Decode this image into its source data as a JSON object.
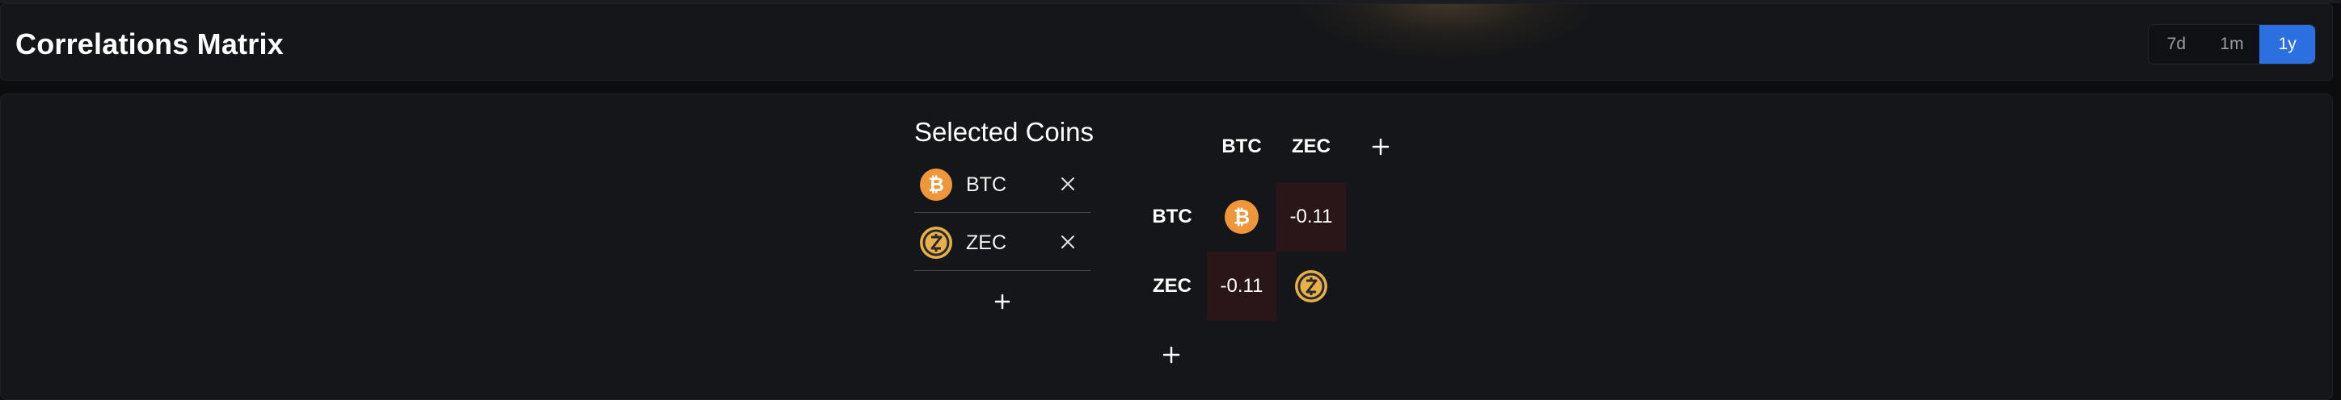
{
  "header": {
    "title": "Correlations Matrix",
    "ranges": [
      {
        "label": "7d",
        "active": false
      },
      {
        "label": "1m",
        "active": false
      },
      {
        "label": "1y",
        "active": true
      }
    ]
  },
  "selected_coins": {
    "title": "Selected Coins",
    "coins": [
      {
        "symbol": "BTC",
        "icon": "bitcoin-icon"
      },
      {
        "symbol": "ZEC",
        "icon": "zcash-icon"
      }
    ],
    "add_icon": "plus-icon",
    "remove_icon": "close-icon"
  },
  "matrix": {
    "columns": [
      "BTC",
      "ZEC"
    ],
    "rows": [
      "BTC",
      "ZEC"
    ],
    "values": [
      [
        null,
        "-0.11"
      ],
      [
        "-0.11",
        null
      ]
    ],
    "add_icon": "plus-icon"
  },
  "colors": {
    "accent": "#2b6fe0",
    "bitcoin": "#f0963a",
    "zcash": "#e8b04a",
    "negative_cell": "#2a1618"
  }
}
